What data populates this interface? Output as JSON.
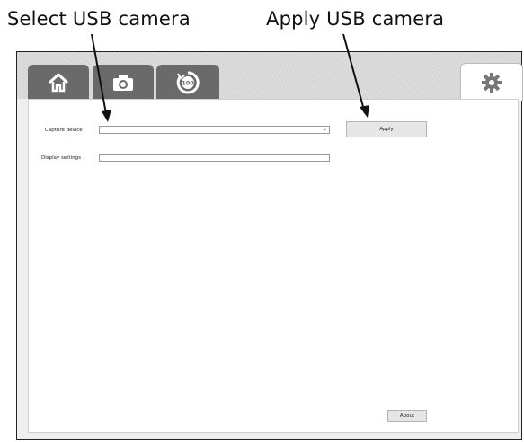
{
  "callouts": {
    "select": "Select USB camera",
    "apply": "Apply USB camera"
  },
  "tabs": [
    {
      "icon": "home-icon"
    },
    {
      "icon": "camera-icon"
    },
    {
      "icon": "timer-100-icon",
      "badge": "100"
    },
    {
      "icon": "gear-icon"
    }
  ],
  "settings": {
    "capture_device_label": "Capture device",
    "capture_device_value": "",
    "display_settings_label": "Display settings",
    "display_settings_value": "",
    "apply_label": "Apply",
    "about_label": "About"
  },
  "colors": {
    "tab_inactive": "#6a6a6a",
    "tab_active": "#ffffff",
    "tabbar_bg": "#dcdcdc"
  }
}
